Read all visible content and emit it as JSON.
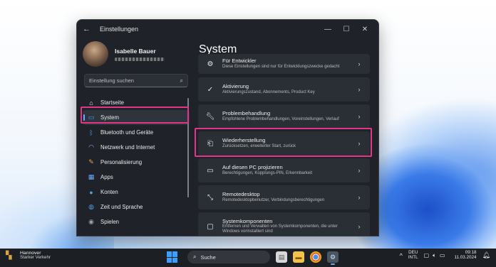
{
  "window": {
    "title": "Einstellungen",
    "back_icon": "arrow-left-icon",
    "controls": [
      "minimize-icon",
      "maximize-icon",
      "close-icon"
    ]
  },
  "profile": {
    "name": "Isabelle Bauer"
  },
  "search": {
    "placeholder": "Einstellung suchen"
  },
  "nav": {
    "items": [
      {
        "label": "Startseite",
        "icon": "home-icon",
        "color": "#e8e8e8"
      },
      {
        "label": "System",
        "icon": "monitor-icon",
        "color": "#3aa0ff",
        "active": true
      },
      {
        "label": "Bluetooth und Geräte",
        "icon": "bluetooth-icon",
        "color": "#3aa0ff"
      },
      {
        "label": "Netzwerk und Internet",
        "icon": "wifi-icon",
        "color": "#7ab8ff"
      },
      {
        "label": "Personalisierung",
        "icon": "brush-icon",
        "color": "#f0a040"
      },
      {
        "label": "Apps",
        "icon": "apps-icon",
        "color": "#6aa9ff"
      },
      {
        "label": "Konten",
        "icon": "person-icon",
        "color": "#4aa0e0"
      },
      {
        "label": "Zeit und Sprache",
        "icon": "globe-icon",
        "color": "#4aa0e0"
      },
      {
        "label": "Spielen",
        "icon": "gamepad-icon",
        "color": "#a0a0a0"
      }
    ]
  },
  "main": {
    "title": "System",
    "cards": [
      {
        "title": "Für Entwickler",
        "subtitle": "Diese Einstellungen sind nur für Entwicklungszwecke gedacht",
        "icon": "developer-icon"
      },
      {
        "title": "Aktivierung",
        "subtitle": "Aktivierungszustand, Abonnements, Product Key",
        "icon": "check-circle-icon"
      },
      {
        "title": "Problembehandlung",
        "subtitle": "Empfohlene Problembehandlungen, Voreinstellungen, Verlauf",
        "icon": "wrench-icon"
      },
      {
        "title": "Wiederherstellung",
        "subtitle": "Zurücksetzen, erweiterter Start, zurück",
        "icon": "recovery-icon"
      },
      {
        "title": "Auf diesen PC projizieren",
        "subtitle": "Berechtigungen, Kopplungs-PIN, Erkennbarkeit",
        "icon": "project-icon"
      },
      {
        "title": "Remotedesktop",
        "subtitle": "Remotedesktopbenutzer, Verbindungsberechtigungen",
        "icon": "remote-desktop-icon"
      },
      {
        "title": "Systemkomponenten",
        "subtitle": "Entfernen und Verwalten von Systemkomponenten, die unter Windows vorinstalliert sind",
        "icon": "components-icon"
      }
    ]
  },
  "taskbar": {
    "weather": {
      "line1": "Hannover",
      "line2": "Starker Verkehr",
      "icon": "traffic-icon"
    },
    "search_label": "Suche",
    "apps": [
      "file-icon",
      "folder-icon",
      "chrome-icon",
      "settings-gear-icon"
    ],
    "tray": {
      "lang1": "DEU",
      "lang2": "INTL",
      "time": "09:18",
      "date": "11.03.2024"
    }
  },
  "colors": {
    "highlight": "#e4358a",
    "accent": "#3aa0ff"
  }
}
